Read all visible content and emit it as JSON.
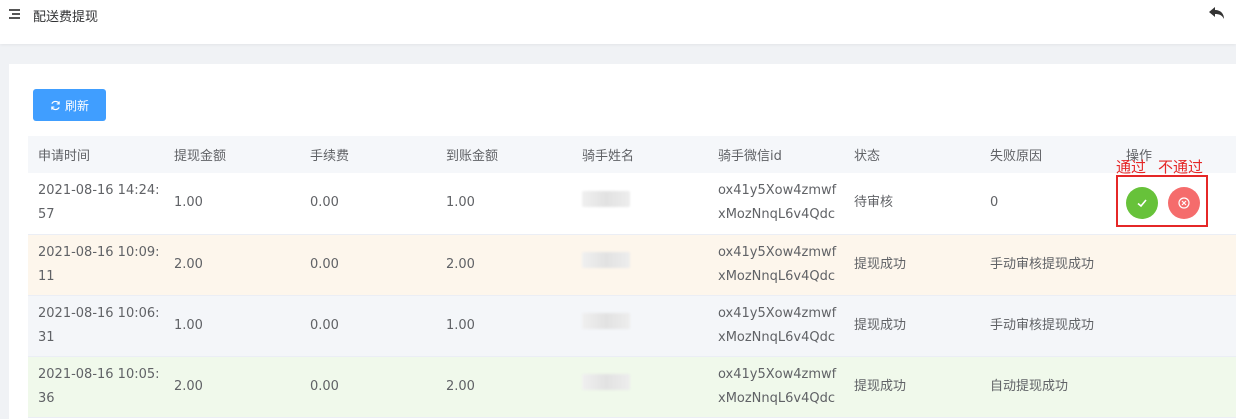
{
  "header": {
    "title": "配送费提现"
  },
  "toolbar": {
    "refresh_label": "刷新"
  },
  "table": {
    "columns": [
      "申请时间",
      "提现金额",
      "手续费",
      "到账金额",
      "骑手姓名",
      "骑手微信id",
      "状态",
      "失败原因",
      "操作"
    ],
    "rows": [
      {
        "time_line1": "2021-08-16 14:24:",
        "time_line2": "57",
        "amount": "1.00",
        "fee": "0.00",
        "received": "1.00",
        "wechat_line1": "ox41y5Xow4zmwf",
        "wechat_line2": "xMozNnqL6v4Qdc",
        "status": "待审核",
        "reason": "0"
      },
      {
        "time_line1": "2021-08-16 10:09:",
        "time_line2": "11",
        "amount": "2.00",
        "fee": "0.00",
        "received": "2.00",
        "wechat_line1": "ox41y5Xow4zmwf",
        "wechat_line2": "xMozNnqL6v4Qdc",
        "status": "提现成功",
        "reason": "手动审核提现成功"
      },
      {
        "time_line1": "2021-08-16 10:06:",
        "time_line2": "31",
        "amount": "1.00",
        "fee": "0.00",
        "received": "1.00",
        "wechat_line1": "ox41y5Xow4zmwf",
        "wechat_line2": "xMozNnqL6v4Qdc",
        "status": "提现成功",
        "reason": "手动审核提现成功"
      },
      {
        "time_line1": "2021-08-16 10:05:",
        "time_line2": "36",
        "amount": "2.00",
        "fee": "0.00",
        "received": "2.00",
        "wechat_line1": "ox41y5Xow4zmwf",
        "wechat_line2": "xMozNnqL6v4Qdc",
        "status": "提现成功",
        "reason": "自动提现成功"
      }
    ]
  },
  "annotations": {
    "approve": "通过",
    "reject": "不通过"
  },
  "icons": {
    "menu": "menu-icon",
    "back": "back-arrow-icon",
    "refresh": "refresh-icon",
    "approve": "check-icon",
    "reject": "close-circle-icon"
  },
  "colors": {
    "primary": "#409eff",
    "success": "#67c23a",
    "danger": "#f56c6c",
    "annotation": "#e52727"
  }
}
